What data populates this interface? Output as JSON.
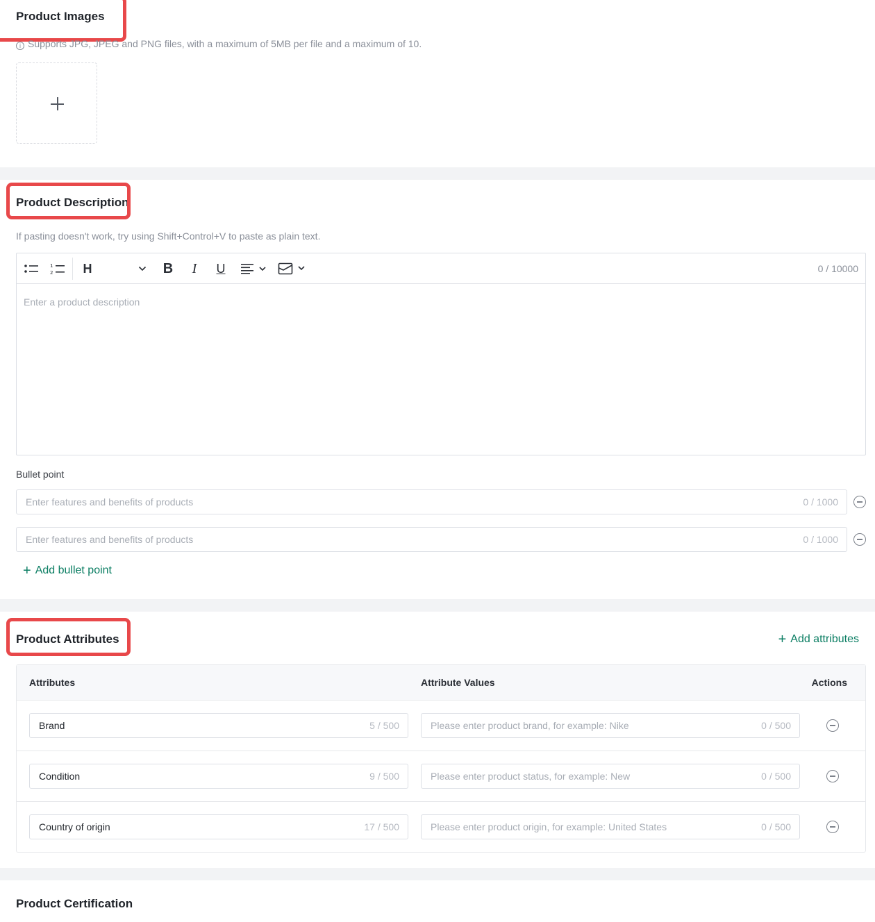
{
  "images": {
    "title": "Product Images",
    "hint": "Supports JPG, JPEG and PNG files, with a maximum of 5MB per file and a maximum of 10.",
    "info_icon": "i"
  },
  "description": {
    "title": "Product Description",
    "hint": "If pasting doesn't work, try using Shift+Control+V to paste as plain text.",
    "editor": {
      "heading_label": "H",
      "bold_label": "B",
      "italic_label": "I",
      "underline_label": "U",
      "counter": "0 / 10000",
      "placeholder": "Enter a product description"
    },
    "bullet_label": "Bullet point",
    "bullets": [
      {
        "placeholder": "Enter features and benefits of products",
        "counter": "0 / 1000"
      },
      {
        "placeholder": "Enter features and benefits of products",
        "counter": "0 / 1000"
      }
    ],
    "add_bullet_label": "Add bullet point"
  },
  "attributes": {
    "title": "Product Attributes",
    "add_label": "Add attributes",
    "columns": [
      "Attributes",
      "Attribute Values",
      "Actions"
    ],
    "rows": [
      {
        "name": "Brand",
        "name_counter": "5 / 500",
        "value_placeholder": "Please enter product brand, for example: Nike",
        "value_counter": "0 / 500"
      },
      {
        "name": "Condition",
        "name_counter": "9 / 500",
        "value_placeholder": "Please enter product status, for example: New",
        "value_counter": "0 / 500"
      },
      {
        "name": "Country of origin",
        "name_counter": "17 / 500",
        "value_placeholder": "Please enter product origin, for example: United States",
        "value_counter": "0 / 500"
      }
    ]
  },
  "certification": {
    "title": "Product Certification"
  },
  "colors": {
    "highlight": "#e8484a",
    "link": "#0a7d62",
    "background": "#f2f3f5"
  }
}
